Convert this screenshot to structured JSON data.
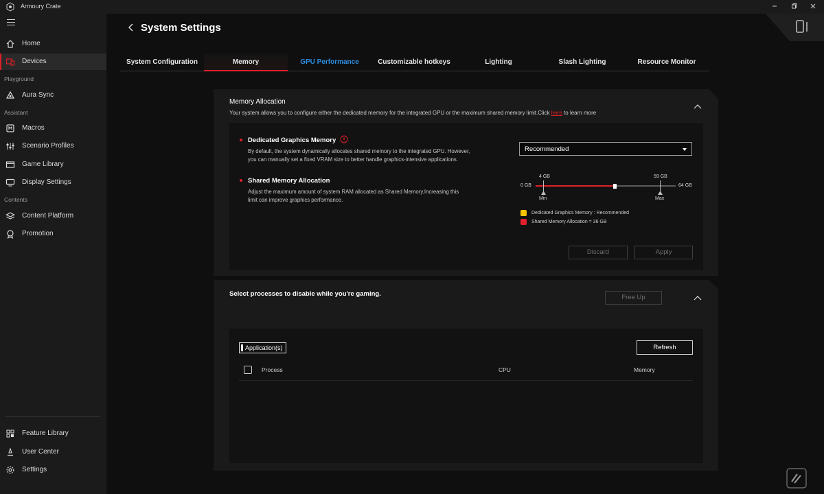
{
  "window": {
    "title": "Armoury Crate"
  },
  "sidebar": {
    "items": [
      {
        "id": "home",
        "label": "Home",
        "icon": "home-icon"
      },
      {
        "id": "devices",
        "label": "Devices",
        "icon": "devices-icon",
        "active": true
      },
      {
        "id": "aura-sync",
        "label": "Aura Sync",
        "icon": "aura-icon"
      },
      {
        "id": "macros",
        "label": "Macros",
        "icon": "macros-icon"
      },
      {
        "id": "scenario-profiles",
        "label": "Scenario Profiles",
        "icon": "sliders-icon"
      },
      {
        "id": "game-library",
        "label": "Game Library",
        "icon": "game-library-icon"
      },
      {
        "id": "display-settings",
        "label": "Display Settings",
        "icon": "display-icon"
      },
      {
        "id": "content-platform",
        "label": "Content Platform",
        "icon": "layers-icon"
      },
      {
        "id": "promotion",
        "label": "Promotion",
        "icon": "badge-icon"
      },
      {
        "id": "feature-library",
        "label": "Feature Library",
        "icon": "grid-icon"
      },
      {
        "id": "user-center",
        "label": "User Center",
        "icon": "user-icon"
      },
      {
        "id": "settings",
        "label": "Settings",
        "icon": "gear-icon"
      }
    ],
    "sections": {
      "playground": "Playground",
      "assistant": "Assistant",
      "contents": "Contents"
    }
  },
  "page": {
    "title": "System Settings"
  },
  "tabs": [
    {
      "label": "System Configuration"
    },
    {
      "label": "Memory",
      "active": true
    },
    {
      "label": "GPU Performance"
    },
    {
      "label": "Customizable hotkeys"
    },
    {
      "label": "Lighting"
    },
    {
      "label": "Slash Lighting"
    },
    {
      "label": "Resource Monitor"
    }
  ],
  "memory_allocation": {
    "title": "Memory Allocation",
    "description": "Your system allows you to configure either the dedicated memory for the integrated GPU or the maximum shared memory limit.Click",
    "link_text": "here",
    "description_suffix": "to learn more",
    "dedicated": {
      "title": "Dedicated Graphics Memory",
      "desc_line1": "By default, the system dynamically allocates shared memory to the integrated GPU. However,",
      "desc_line2": "you can manually set a fixed VRAM size to better handle graphics-intensive applications.",
      "selected": "Recommended"
    },
    "shared": {
      "title": "Shared Memory Allocation",
      "desc_line1": "Adjust the maximum amount of system RAM allocated as Shared Memory.Increasing this",
      "desc_line2": "limit can improve graphics performance."
    },
    "slider": {
      "min_label": "0 GB",
      "max_label": "64 GB",
      "min_mark_value": "4 GB",
      "max_mark_value": "59 GB",
      "min_text": "Min",
      "max_text": "Max",
      "value_gb": 36,
      "range_gb": [
        0,
        64
      ]
    },
    "legend": {
      "dedicated": "Dedicated Graphics Memory : Recommended",
      "shared": "Shared Memory Allocation = 36 GB"
    },
    "discard_label": "Discard",
    "apply_label": "Apply"
  },
  "processes": {
    "title": "Select processes to disable while you're gaming.",
    "free_up_label": "Free Up",
    "filter_label": "Application(s)",
    "refresh_label": "Refresh",
    "columns": {
      "process": "Process",
      "cpu": "CPU",
      "memory": "Memory"
    }
  },
  "colors": {
    "accent": "#e0202a",
    "link": "#2d8ee0",
    "legend_yellow": "#f5c400",
    "legend_red": "#e0202a"
  }
}
